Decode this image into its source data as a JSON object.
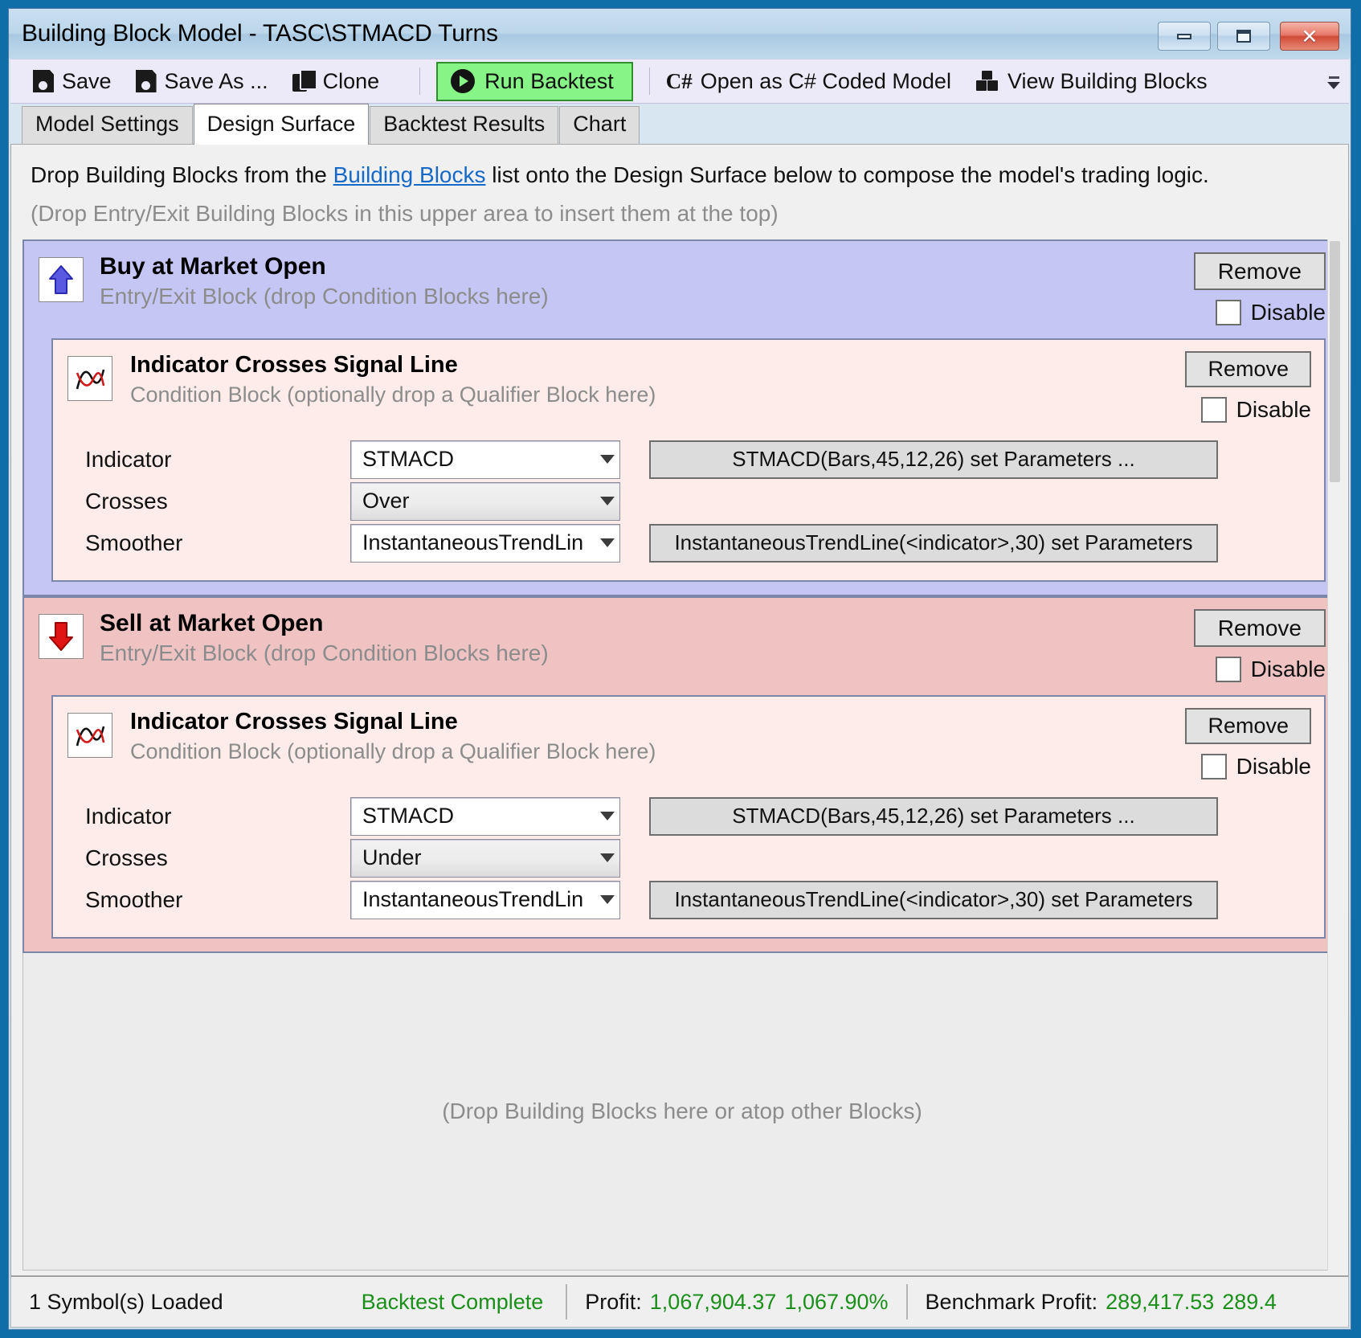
{
  "window": {
    "title": "Building Block Model - TASC\\STMACD Turns",
    "minimize_label": "Minimize",
    "maximize_label": "Restore",
    "close_label": "Close"
  },
  "toolbar": {
    "save_label": "Save",
    "save_as_label": "Save As ...",
    "clone_label": "Clone",
    "run_backtest_label": "Run Backtest",
    "open_csharp_label": "Open as C# Coded Model",
    "csharp_glyph": "C#",
    "view_blocks_label": "View Building Blocks",
    "run_backtest_bg": "#86f486",
    "run_backtest_border": "#2f8f2f"
  },
  "tabs": [
    {
      "label": "Model Settings",
      "active": false
    },
    {
      "label": "Design Surface",
      "active": true
    },
    {
      "label": "Backtest Results",
      "active": false
    },
    {
      "label": "Chart",
      "active": false
    }
  ],
  "intro": {
    "before_link": "Drop Building Blocks from the ",
    "link_text": "Building Blocks",
    "after_link": " list onto the Design Surface below to compose the model's trading logic.",
    "hint": "(Drop Entry/Exit Building Blocks in this upper area to insert them at the top)"
  },
  "blocks": [
    {
      "title": "Buy at Market Open",
      "subtitle": "Entry/Exit Block (drop Condition Blocks here)",
      "icon": "arrow-up-icon",
      "bg": "#c6c6f5",
      "remove_label": "Remove",
      "disable_label": "Disable",
      "disabled_checked": false,
      "condition": {
        "title": "Indicator Crosses Signal Line",
        "subtitle": "Condition Block (optionally drop a Qualifier Block here)",
        "icon": "crossing-lines-icon",
        "bg": "#fdecea",
        "remove_label": "Remove",
        "disable_label": "Disable",
        "disabled_checked": false,
        "rows": [
          {
            "label": "Indicator",
            "value": "STMACD",
            "style": "white",
            "param_button": "STMACD(Bars,45,12,26) set Parameters ..."
          },
          {
            "label": "Crosses",
            "value": "Over",
            "style": "gray",
            "param_button": ""
          },
          {
            "label": "Smoother",
            "value": "InstantaneousTrendLin",
            "style": "white",
            "param_button": "InstantaneousTrendLine(<indicator>,30) set Parameters"
          }
        ]
      }
    },
    {
      "title": "Sell at Market Open",
      "subtitle": "Entry/Exit Block (drop Condition Blocks here)",
      "icon": "arrow-down-icon",
      "bg": "#f0c3c3",
      "remove_label": "Remove",
      "disable_label": "Disable",
      "disabled_checked": false,
      "condition": {
        "title": "Indicator Crosses Signal Line",
        "subtitle": "Condition Block (optionally drop a Qualifier Block here)",
        "icon": "crossing-lines-icon",
        "bg": "#fdecea",
        "remove_label": "Remove",
        "disable_label": "Disable",
        "disabled_checked": false,
        "rows": [
          {
            "label": "Indicator",
            "value": "STMACD",
            "style": "white",
            "param_button": "STMACD(Bars,45,12,26) set Parameters ..."
          },
          {
            "label": "Crosses",
            "value": "Under",
            "style": "gray",
            "param_button": ""
          },
          {
            "label": "Smoother",
            "value": "InstantaneousTrendLin",
            "style": "white",
            "param_button": "InstantaneousTrendLine(<indicator>,30) set Parameters"
          }
        ]
      }
    }
  ],
  "dropzone": {
    "text": "(Drop Building Blocks here or atop other Blocks)"
  },
  "statusbar": {
    "symbols_loaded": "1 Symbol(s) Loaded",
    "backtest_status": "Backtest Complete",
    "profit_label": "Profit:",
    "profit_value": "1,067,904.37",
    "profit_percent": "1,067.90%",
    "benchmark_label": "Benchmark Profit:",
    "benchmark_value": "289,417.53",
    "benchmark_percent": "289.4",
    "status_color": "#1a8f1a"
  }
}
